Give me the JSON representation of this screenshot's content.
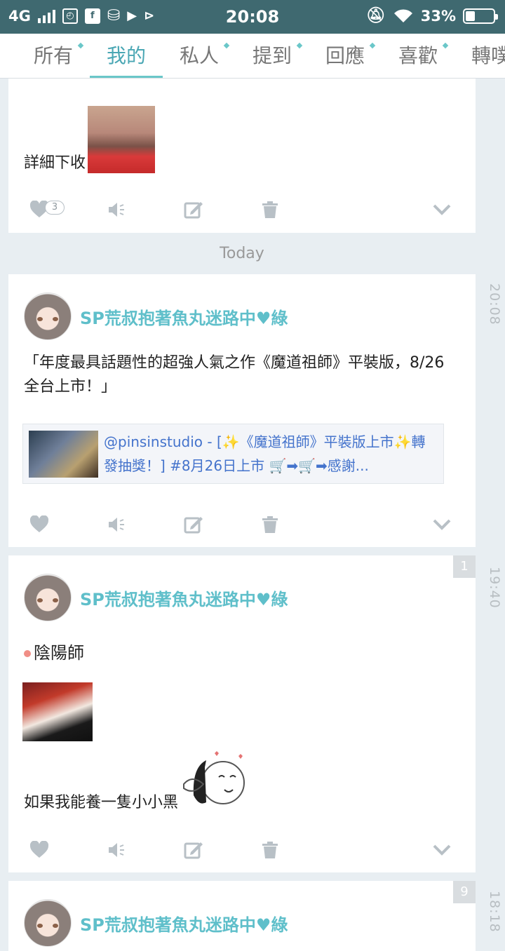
{
  "status_bar": {
    "network": "4G",
    "time": "20:08",
    "battery_percent": "33%",
    "battery_level": 0.33,
    "icons": [
      "signal-icon",
      "alarm-icon",
      "facebook-icon",
      "db-icon",
      "youtube-icon",
      "play-icon",
      "mute-icon",
      "wifi-icon",
      "battery-icon"
    ]
  },
  "tabs": [
    {
      "label": "所有",
      "dot": true,
      "active": false
    },
    {
      "label": "我的",
      "dot": false,
      "active": true
    },
    {
      "label": "私人",
      "dot": true,
      "active": false
    },
    {
      "label": "提到",
      "dot": true,
      "active": false
    },
    {
      "label": "回應",
      "dot": true,
      "active": false
    },
    {
      "label": "喜歡",
      "dot": true,
      "active": false
    },
    {
      "label": "轉噗",
      "dot": false,
      "active": false
    }
  ],
  "post0": {
    "text": "詳細下收",
    "like_count": "3"
  },
  "divider": {
    "label": "Today"
  },
  "timeline": [
    "20:08",
    "19:40",
    "18:18"
  ],
  "author": {
    "name": "SP荒叔抱著魚丸迷路中♥綠"
  },
  "post1": {
    "text": "「年度最具話題性的超強人氣之作《魔道祖師》平裝版，8/26全台上市！」",
    "link_text": "@pinsinstudio - [✨《魔道祖師》平裝版上市✨轉發抽獎！] #8月26日上市 🛒➡🛒➡感謝..."
  },
  "post2": {
    "badge": "1",
    "bullet_text": "陰陽師",
    "text": "如果我能養一隻小小黑"
  },
  "post3": {
    "badge": "9"
  }
}
